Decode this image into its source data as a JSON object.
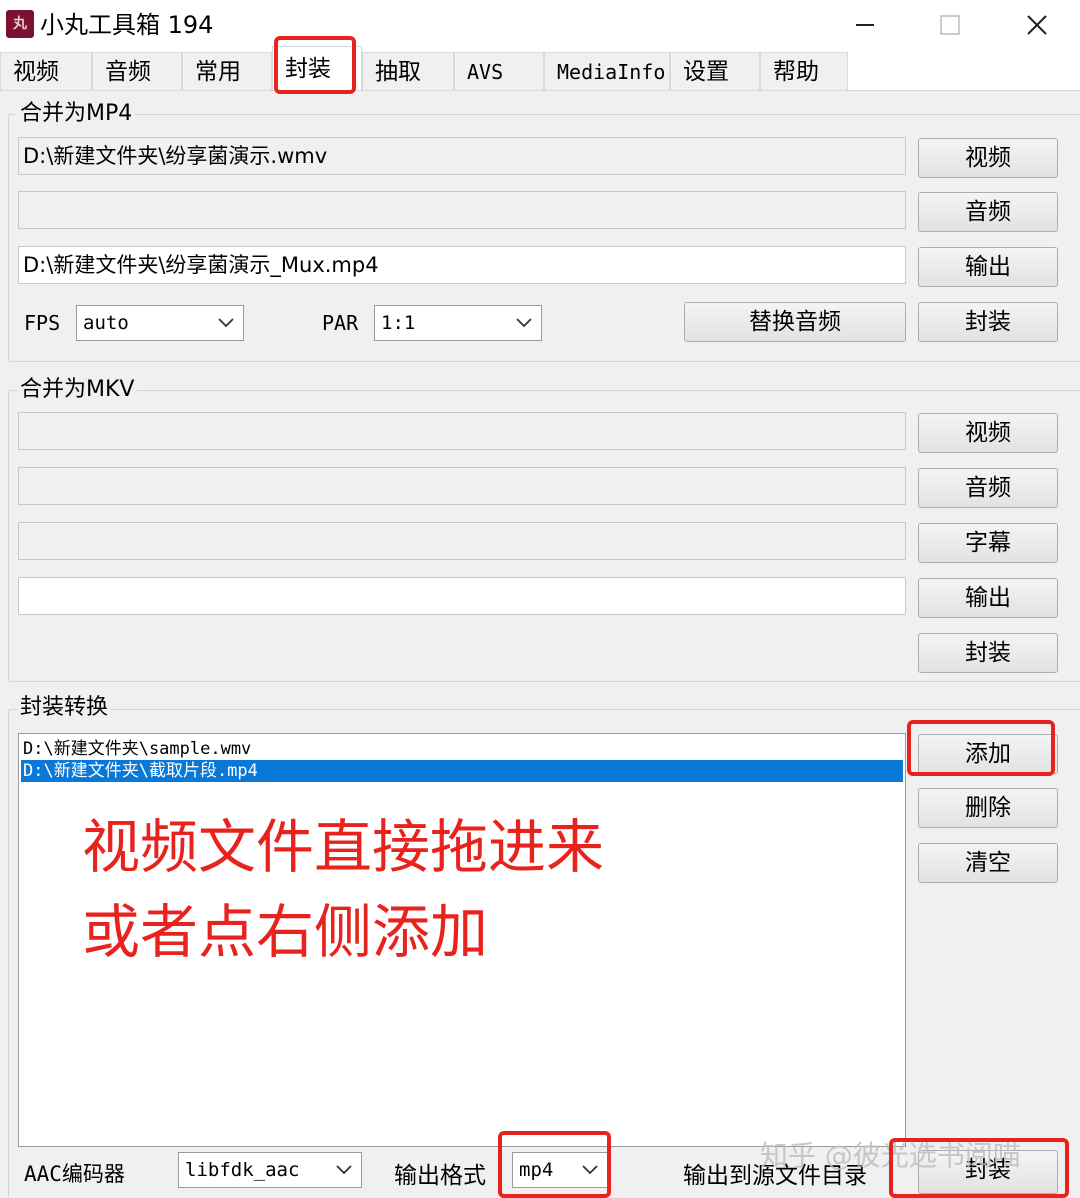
{
  "window": {
    "title": "小丸工具箱 194",
    "icon_text": "丸"
  },
  "tabs": [
    "视频",
    "音频",
    "常用",
    "封装",
    "抽取",
    "AVS",
    "MediaInfo",
    "设置",
    "帮助"
  ],
  "active_tab": "封装",
  "mp4_group": {
    "label": "合并为MP4",
    "video_path": "D:\\新建文件夹\\纷享菌演示.wmv",
    "audio_path": "",
    "output_path": "D:\\新建文件夹\\纷享菌演示_Mux.mp4",
    "btn_video": "视频",
    "btn_audio": "音频",
    "btn_output": "输出",
    "fps_label": "FPS",
    "fps_value": "auto",
    "par_label": "PAR",
    "par_value": "1:1",
    "btn_replace_audio": "替换音频",
    "btn_mux": "封装"
  },
  "mkv_group": {
    "label": "合并为MKV",
    "video_path": "",
    "audio_path": "",
    "subtitle_path": "",
    "output_path": "",
    "btn_video": "视频",
    "btn_audio": "音频",
    "btn_subtitle": "字幕",
    "btn_output": "输出",
    "btn_mux": "封装"
  },
  "convert_group": {
    "label": "封装转换",
    "files": [
      "D:\\新建文件夹\\sample.wmv",
      "D:\\新建文件夹\\截取片段.mp4"
    ],
    "selected_index": 1,
    "btn_add": "添加",
    "btn_delete": "删除",
    "btn_clear": "清空",
    "aac_label": "AAC编码器",
    "aac_value": "libfdk_aac",
    "format_label": "输出格式",
    "format_value": "mp4",
    "output_to_source_label": "输出到源文件目录",
    "btn_mux": "封装"
  },
  "annotation": {
    "line1": "视频文件直接拖进来",
    "line2": "或者点右侧添加",
    "color": "#e8231e"
  },
  "watermark": "知乎 @彼光选书阅喵",
  "colors": {
    "panel_bg": "#f0f0f0",
    "selection": "#0a78d7",
    "highlight_red": "#e8231e"
  }
}
